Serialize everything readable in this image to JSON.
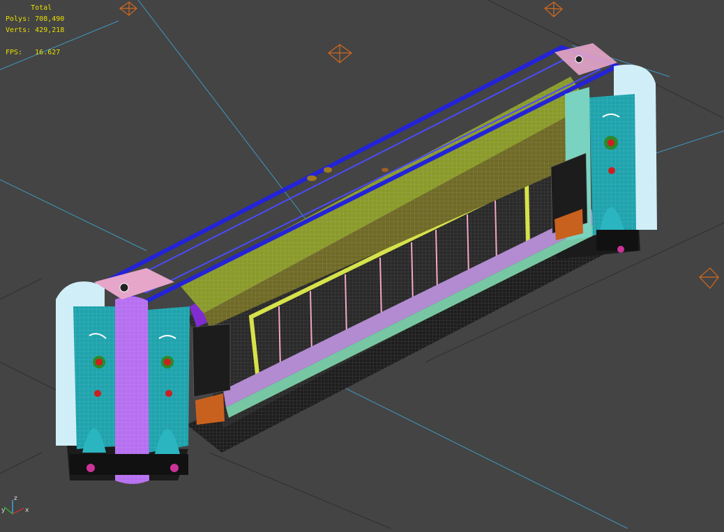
{
  "stats": {
    "header": "Total",
    "polys_label": "Polys:",
    "polys_value": "708,490",
    "verts_label": "Verts:",
    "verts_value": "429,218",
    "fps_label": "FPS:",
    "fps_value": "16.627"
  },
  "axis": {
    "x": "x",
    "y": "y",
    "z": "z"
  },
  "colors": {
    "background": "#444444",
    "stats_text": "#e8e000",
    "grid_line": "#3fa7d6",
    "camera": "#d2691e",
    "outline": "#2323d8",
    "glass": "#b9c53a",
    "stripe": "#8a2be2",
    "cab_cyan": "#2bb5c0",
    "buffer_light": "#cfeef7",
    "underframe": "#1b1b1b"
  }
}
